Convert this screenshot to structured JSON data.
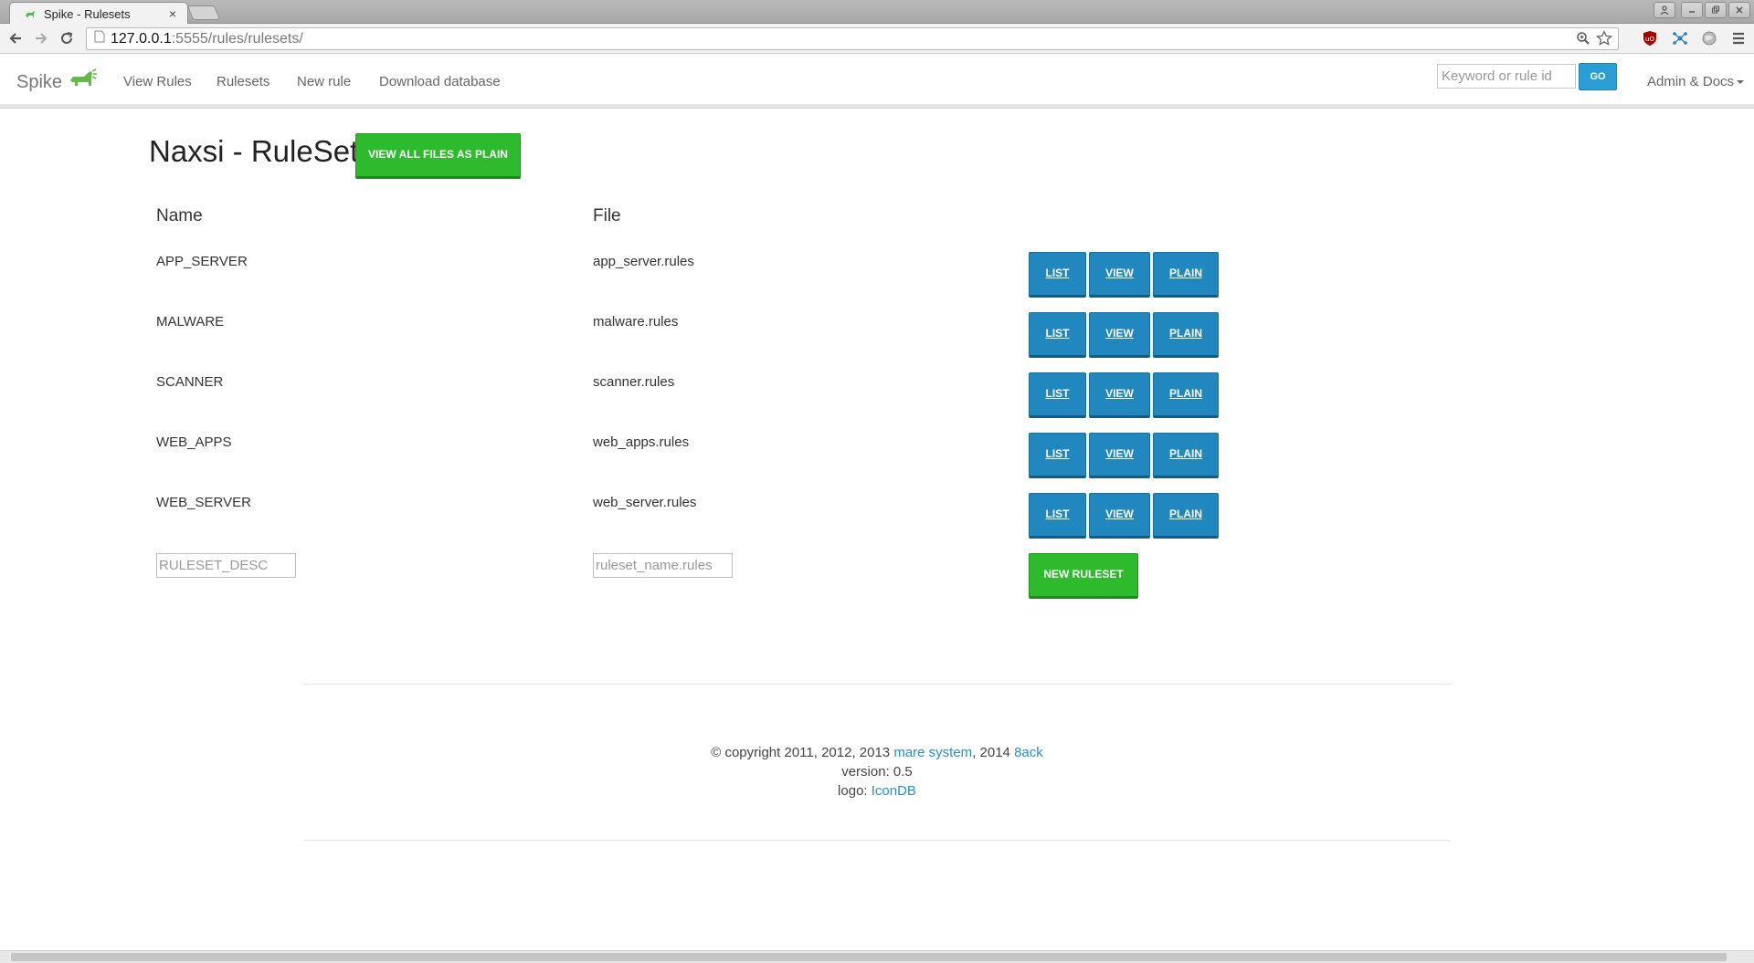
{
  "browser": {
    "tab_title": "Spike - Rulesets",
    "tab_close": "×",
    "url_host": "127.0.0.1",
    "url_path": ":5555/rules/rulesets/"
  },
  "navbar": {
    "brand": "Spike",
    "links": [
      "View Rules",
      "Rulesets",
      "New rule",
      "Download database"
    ],
    "search_placeholder": "Keyword or rule id",
    "go_label": "GO",
    "admin_label": "Admin & Docs"
  },
  "page": {
    "title": "Naxsi - RuleSets",
    "view_all_label": "VIEW ALL FILES AS PLAIN"
  },
  "table": {
    "headers": {
      "name": "Name",
      "file": "File"
    },
    "rows": [
      {
        "name": "APP_SERVER",
        "file": "app_server.rules",
        "list": "LIST",
        "view": "VIEW",
        "plain": "PLAIN"
      },
      {
        "name": "MALWARE",
        "file": "malware.rules",
        "list": "LIST",
        "view": "VIEW",
        "plain": "PLAIN"
      },
      {
        "name": "SCANNER",
        "file": "scanner.rules",
        "list": "LIST",
        "view": "VIEW",
        "plain": "PLAIN"
      },
      {
        "name": "WEB_APPS",
        "file": "web_apps.rules",
        "list": "LIST",
        "view": "VIEW",
        "plain": "PLAIN"
      },
      {
        "name": "WEB_SERVER",
        "file": "web_server.rules",
        "list": "LIST",
        "view": "VIEW",
        "plain": "PLAIN"
      }
    ],
    "new_desc_placeholder": "RULESET_DESC",
    "new_file_placeholder": "ruleset_name.rules",
    "new_ruleset_label": "NEW RULESET"
  },
  "footer": {
    "copyright_prefix": "© copyright 2011, 2012, 2013 ",
    "link1": "mare system",
    "middle": ", 2014 ",
    "link2": "8ack",
    "version": "version: 0.5",
    "logo_prefix": "logo: ",
    "logo_link": "IconDB"
  },
  "colors": {
    "accent_blue": "#2188bf",
    "accent_green": "#2dbb2d",
    "link": "#2a8fc7"
  }
}
